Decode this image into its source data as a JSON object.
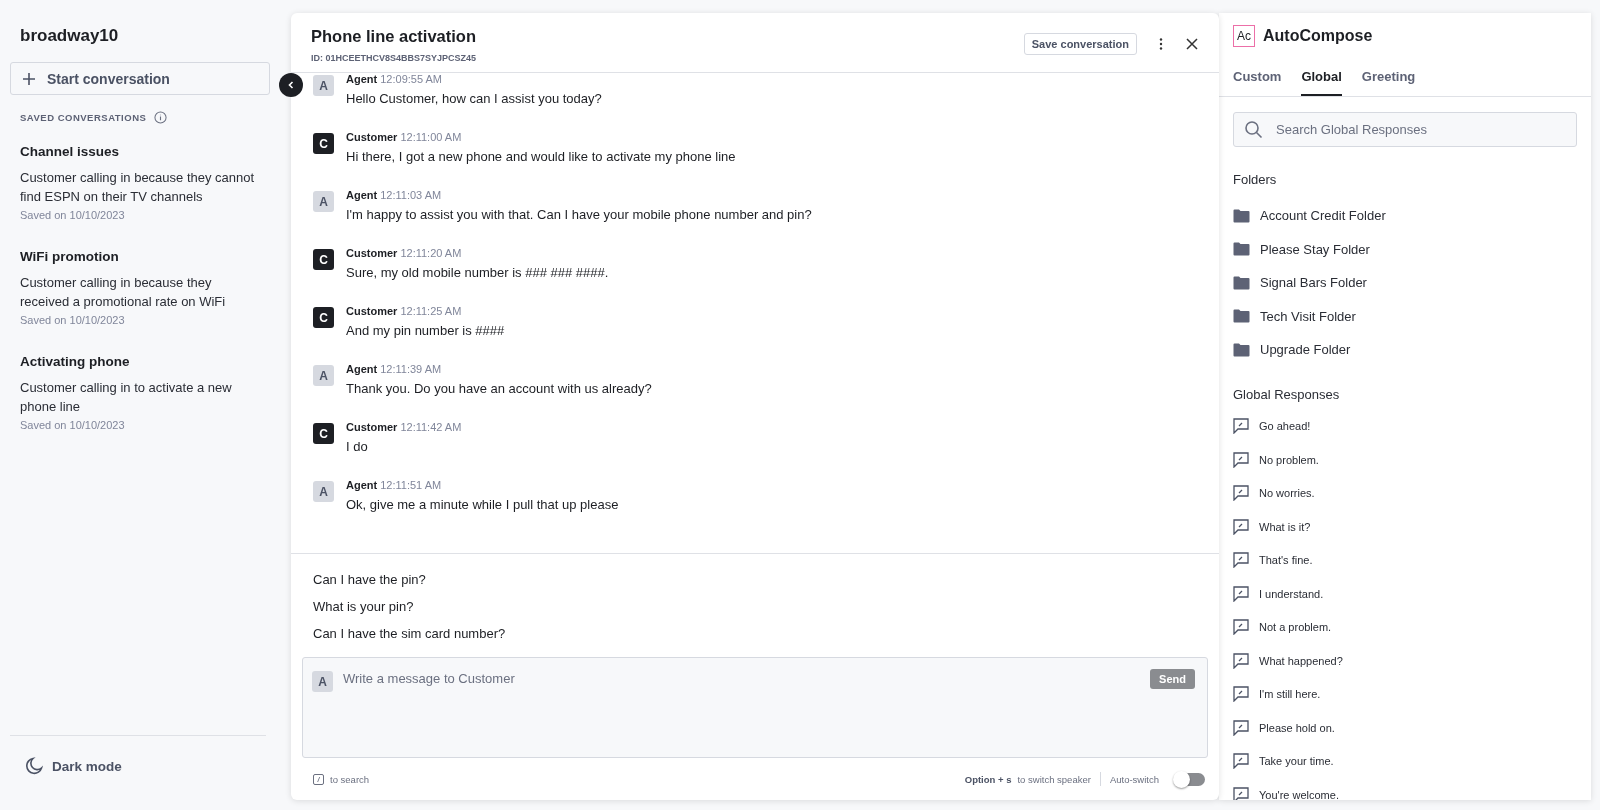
{
  "sidebar": {
    "account": "broadway10",
    "start_button": "Start conversation",
    "section_title": "SAVED CONVERSATIONS",
    "saved": [
      {
        "title": "Channel issues",
        "summary": "Customer calling in because they cannot find ESPN on their TV channels",
        "date": "Saved on 10/10/2023"
      },
      {
        "title": "WiFi promotion",
        "summary": "Customer calling in because they received a promotional rate on WiFi",
        "date": "Saved on 10/10/2023"
      },
      {
        "title": "Activating phone",
        "summary": "Customer calling in to activate a new phone line",
        "date": "Saved on 10/10/2023"
      }
    ],
    "dark_mode": "Dark mode"
  },
  "conversation": {
    "title": "Phone line activation",
    "id": "ID: 01HCEETHCV8S4BBS7SYJPCSZ45",
    "save_button": "Save conversation",
    "messages": [
      {
        "kind": "agent",
        "avatar": "A",
        "speaker": "Agent",
        "time": "12:09:55 AM",
        "text": "Hello Customer, how can I assist you today?"
      },
      {
        "kind": "customer",
        "avatar": "C",
        "speaker": "Customer",
        "time": "12:11:00 AM",
        "text": "Hi there, I got a new phone and would like to activate my phone line"
      },
      {
        "kind": "agent",
        "avatar": "A",
        "speaker": "Agent",
        "time": "12:11:03 AM",
        "text": "I'm happy to assist you with that. Can I have your mobile phone number and pin?"
      },
      {
        "kind": "customer",
        "avatar": "C",
        "speaker": "Customer",
        "time": "12:11:20 AM",
        "text": "Sure, my old mobile number is ### ### ####."
      },
      {
        "kind": "customer",
        "avatar": "C",
        "speaker": "Customer",
        "time": "12:11:25 AM",
        "text": "And my pin number is ####"
      },
      {
        "kind": "agent",
        "avatar": "A",
        "speaker": "Agent",
        "time": "12:11:39 AM",
        "text": "Thank you. Do you have an account with us already?"
      },
      {
        "kind": "customer",
        "avatar": "C",
        "speaker": "Customer",
        "time": "12:11:42 AM",
        "text": "I do"
      },
      {
        "kind": "agent",
        "avatar": "A",
        "speaker": "Agent",
        "time": "12:11:51 AM",
        "text": "Ok, give me a minute while I pull that up please"
      }
    ],
    "suggestions": [
      "Can I have the pin?",
      "What is your pin?",
      "Can I have the sim card number?"
    ],
    "composer": {
      "avatar": "A",
      "placeholder": "Write a message to Customer",
      "send_button": "Send",
      "send_disabled": true
    },
    "footer": {
      "search_key": "/",
      "search_hint": "to search",
      "shortcut": "Option + s",
      "shortcut_hint": "to switch speaker",
      "auto_switch": "Auto-switch",
      "auto_switch_on": false
    }
  },
  "autocompose": {
    "logo": "Ac",
    "title": "AutoCompose",
    "tabs": [
      {
        "label": "Custom",
        "selected": false
      },
      {
        "label": "Global",
        "selected": true
      },
      {
        "label": "Greeting",
        "selected": false
      }
    ],
    "search": {
      "placeholder": "Search Global Responses"
    },
    "folders_title": "Folders",
    "folders": [
      "Account Credit Folder",
      "Please Stay Folder",
      "Signal Bars Folder",
      "Tech Visit Folder",
      "Upgrade Folder"
    ],
    "responses_title": "Global Responses",
    "responses": [
      "Go ahead!",
      "No problem.",
      "No worries.",
      "What is it?",
      "That's fine.",
      "I understand.",
      "Not a problem.",
      "What happened?",
      "I'm still here.",
      "Please hold on.",
      "Take your time.",
      "You're welcome."
    ]
  }
}
